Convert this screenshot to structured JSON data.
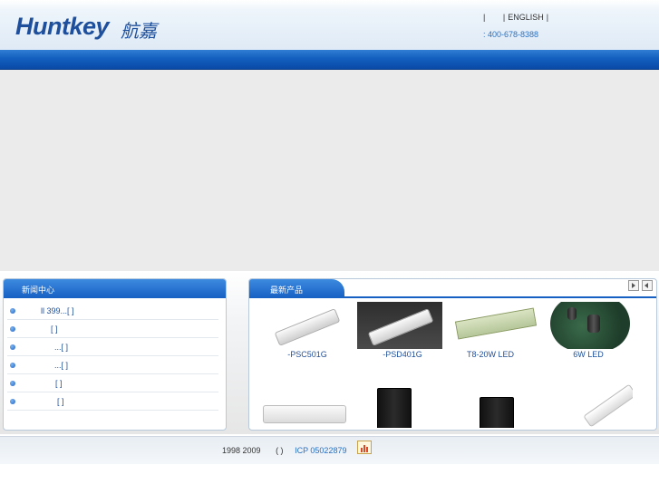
{
  "header": {
    "logo_text": "Huntkey",
    "logo_cn": "航嘉",
    "links": [
      "|",
      "|",
      "ENGLISH",
      "|"
    ],
    "phone": ": 400-678-8388"
  },
  "news": {
    "title": "新闻中心",
    "items": [
      {
        "text": "ll 399...[  ]"
      },
      {
        "text": "[  ]"
      },
      {
        "text": "...[  ]"
      },
      {
        "text": "...[  ]"
      },
      {
        "text": "[  ]"
      },
      {
        "text": "[  ]"
      }
    ]
  },
  "products": {
    "title": "最新产品",
    "items": [
      {
        "caption": "-PSC501G"
      },
      {
        "caption": "-PSD401G"
      },
      {
        "caption": "T8-20W LED"
      },
      {
        "caption": "6W   LED"
      }
    ]
  },
  "footer": {
    "copyright": "1998 2009",
    "paren": "(  )",
    "icp": "ICP 05022879"
  },
  "colors": {
    "brand_blue": "#1d4f9d",
    "nav_blue": "#135fbf",
    "link_blue": "#2a6fc0"
  }
}
